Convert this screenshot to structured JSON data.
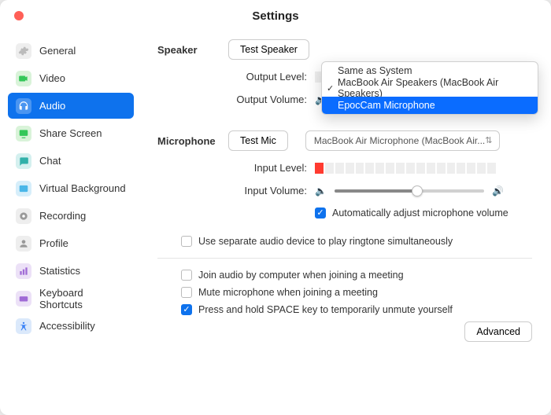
{
  "window": {
    "title": "Settings"
  },
  "sidebar": {
    "items": [
      {
        "label": "General"
      },
      {
        "label": "Video"
      },
      {
        "label": "Audio"
      },
      {
        "label": "Share Screen"
      },
      {
        "label": "Chat"
      },
      {
        "label": "Virtual Background"
      },
      {
        "label": "Recording"
      },
      {
        "label": "Profile"
      },
      {
        "label": "Statistics"
      },
      {
        "label": "Keyboard Shortcuts"
      },
      {
        "label": "Accessibility"
      }
    ]
  },
  "audio": {
    "speaker_label": "Speaker",
    "test_speaker": "Test Speaker",
    "output_level_label": "Output Level:",
    "output_volume_label": "Output Volume:",
    "microphone_label": "Microphone",
    "test_mic": "Test Mic",
    "mic_device": "MacBook Air Microphone (MacBook Air...",
    "input_level_label": "Input Level:",
    "input_volume_label": "Input Volume:",
    "auto_adjust": "Automatically adjust microphone volume",
    "separate_device": "Use separate audio device to play ringtone simultaneously",
    "join_audio": "Join audio by computer when joining a meeting",
    "mute_on_join": "Mute microphone when joining a meeting",
    "space_unmute": "Press and hold SPACE key to temporarily unmute yourself",
    "advanced": "Advanced"
  },
  "dropdown": {
    "opt0": "Same as System",
    "opt1": "MacBook Air Speakers (MacBook Air Speakers)",
    "opt2": "EpocCam Microphone"
  }
}
